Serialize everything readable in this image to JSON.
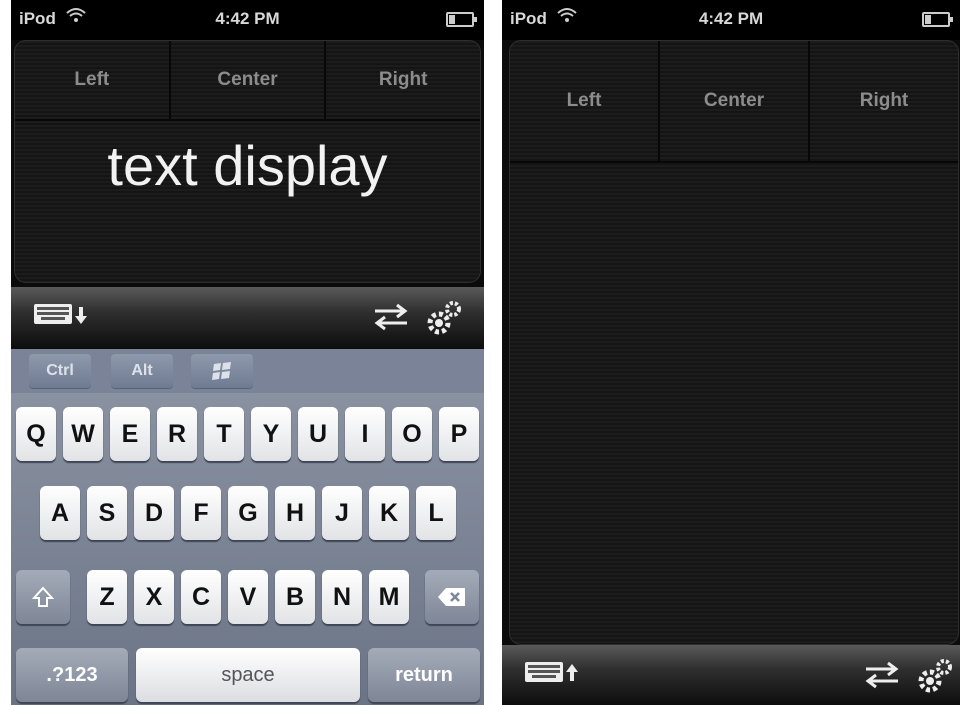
{
  "status": {
    "carrier": "iPod",
    "time": "4:42 PM"
  },
  "mouse_buttons": {
    "left": "Left",
    "center": "Center",
    "right": "Right"
  },
  "display": {
    "text": "text display"
  },
  "modifier_keys": {
    "ctrl": "Ctrl",
    "alt": "Alt",
    "win_icon": "windows-logo-icon"
  },
  "keyboard": {
    "row1": [
      "Q",
      "W",
      "E",
      "R",
      "T",
      "Y",
      "U",
      "I",
      "O",
      "P"
    ],
    "row2": [
      "A",
      "S",
      "D",
      "F",
      "G",
      "H",
      "J",
      "K",
      "L"
    ],
    "row3": [
      "Z",
      "X",
      "C",
      "V",
      "B",
      "N",
      "M"
    ],
    "numbers_label": ".?123",
    "space_label": "space",
    "return_label": "return"
  },
  "icons": [
    "wifi-icon",
    "battery-icon",
    "keyboard-icon",
    "arrow-down-icon",
    "arrow-up-icon",
    "swap-icon",
    "gears-icon",
    "shift-icon",
    "backspace-icon"
  ]
}
